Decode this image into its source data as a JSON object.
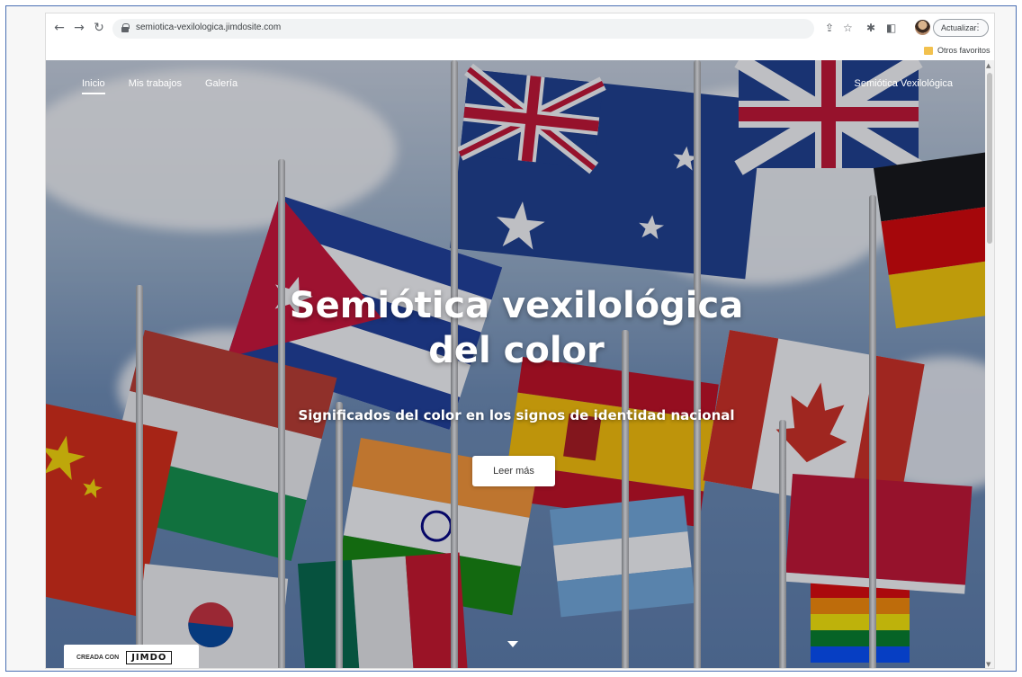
{
  "browser": {
    "url": "semiotica-vexilologica.jimdosite.com",
    "update_label": "Actualizar",
    "bookmarks_folder": "Otros favoritos",
    "icons": [
      "back-icon",
      "forward-icon",
      "reload-icon",
      "lock-icon",
      "share-icon",
      "star-icon",
      "extensions-icon",
      "sidepanel-icon",
      "kebab-menu-icon"
    ]
  },
  "site": {
    "nav": [
      {
        "label": "Inicio",
        "active": true
      },
      {
        "label": "Mis trabajos",
        "active": false
      },
      {
        "label": "Galería",
        "active": false
      }
    ],
    "brand": "Semiótica Vexilológica",
    "hero": {
      "title": "Semiótica vexilológica\ndel color",
      "subtitle": "Significados del color en los signos de identidad nacional",
      "cta": "Leer más"
    },
    "badge": {
      "made_with": "CREADA CON",
      "logo": "JIMDO"
    }
  }
}
